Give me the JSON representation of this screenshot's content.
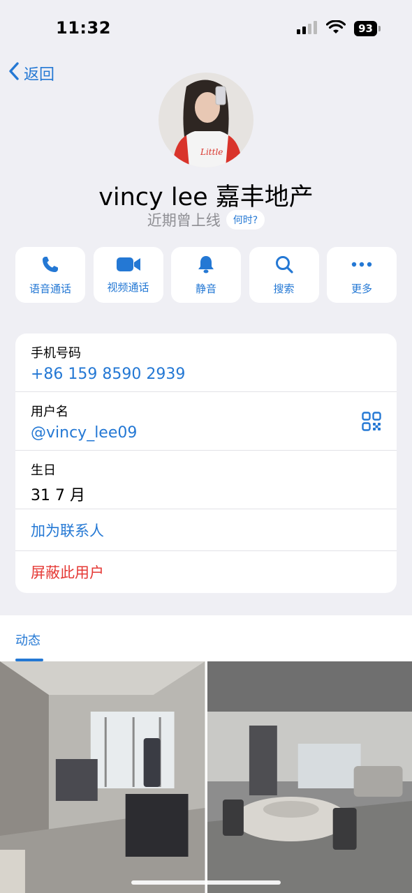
{
  "status_bar": {
    "time": "11:32",
    "battery": "93"
  },
  "nav": {
    "back_label": "返回"
  },
  "profile": {
    "name": "vincy lee 嘉丰地产",
    "presence": "近期曾上线",
    "when_chip": "何时?"
  },
  "actions": [
    {
      "label": "语音通话",
      "icon": "phone-icon"
    },
    {
      "label": "视频通话",
      "icon": "video-camera-icon"
    },
    {
      "label": "静音",
      "icon": "bell-icon"
    },
    {
      "label": "搜索",
      "icon": "search-icon"
    },
    {
      "label": "更多",
      "icon": "more-dots-icon"
    }
  ],
  "info": {
    "phone_label": "手机号码",
    "phone_value": "+86 159 8590 2939",
    "username_label": "用户名",
    "username_value": "@vincy_lee09",
    "birthday_label": "生日",
    "birthday_value": "31 7 月",
    "add_contact": "加为联系人",
    "block_user": "屏蔽此用户"
  },
  "posts": {
    "tab_label": "动态"
  },
  "colors": {
    "accent": "#2478d4",
    "danger": "#e53935",
    "background": "#efeff4"
  }
}
